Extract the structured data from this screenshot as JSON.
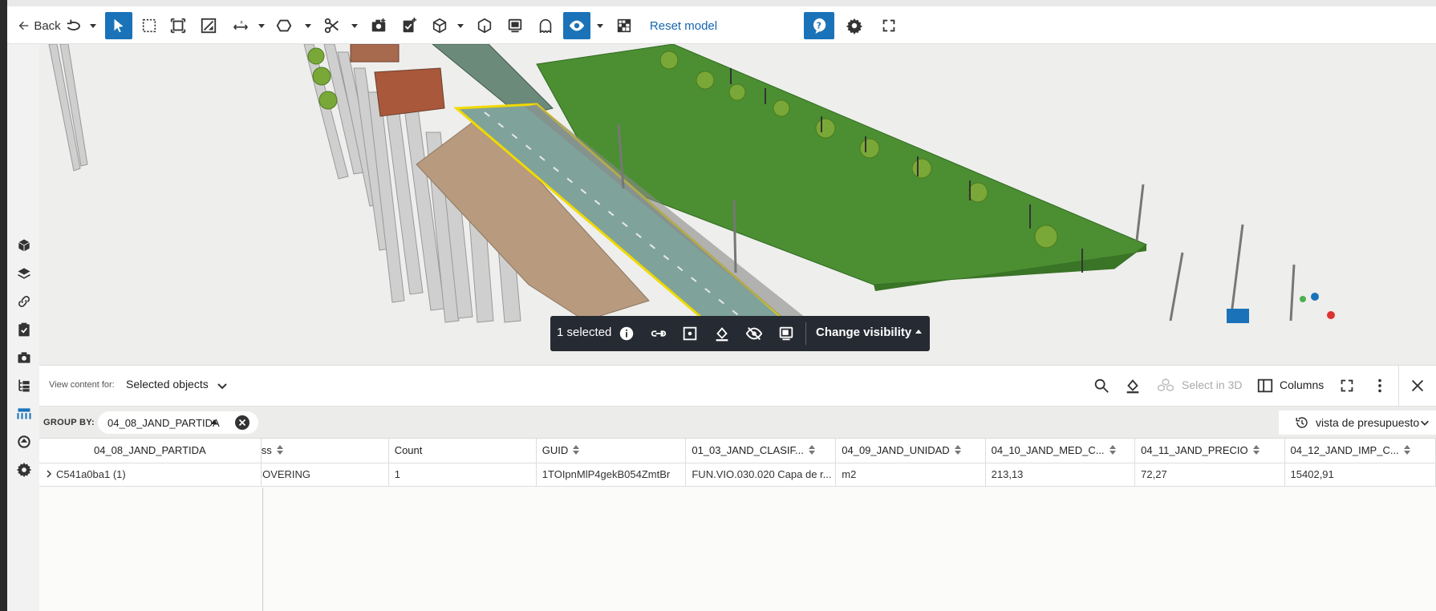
{
  "toolbar": {
    "back_label": "Back",
    "reset_label": "Reset model",
    "icons": [
      "arrow-left-icon",
      "orbit-icon",
      "cursor-icon",
      "box-select-icon",
      "fit-icon",
      "section-icon",
      "measure-icon",
      "shape-icon",
      "scissors-icon",
      "camera-add-icon",
      "clipboard-add-icon",
      "cube-icon",
      "cube-outline-icon",
      "viewer-icon",
      "ghost-icon",
      "eye-icon",
      "checker-icon",
      "help-icon",
      "gear-icon",
      "fullscreen-icon"
    ],
    "accent": "#1a73b8"
  },
  "sidebar": {
    "items": [
      "cube-icon",
      "layers-icon",
      "link-icon",
      "clipboard-check-icon",
      "camera-icon",
      "tree-icon",
      "table-icon",
      "shapes-icon",
      "settings-gear-icon"
    ]
  },
  "selection_bar": {
    "count_label": "1 selected",
    "change_visibility_label": "Change visibility"
  },
  "panel": {
    "view_content_for_label": "View content for:",
    "view_content_for_value": "Selected objects",
    "select_in_3d_label": "Select in 3D",
    "columns_label": "Columns",
    "group_by_label": "GROUP BY:",
    "group_by_value": "04_08_JAND_PARTIDA",
    "view_preset": "vista de presupuesto"
  },
  "table": {
    "columns": [
      "04_08_JAND_PARTIDA",
      "ss",
      "Count",
      "GUID",
      "01_03_JAND_CLASIF...",
      "04_09_JAND_UNIDAD",
      "04_10_JAND_MED_C...",
      "04_11_JAND_PRECIO",
      "04_12_JAND_IMP_C..."
    ],
    "rows": [
      [
        "C541a0ba1 (1)",
        "COVERING",
        "1",
        "1TOIpnMlP4gekB054ZmtBr",
        "FUN.VIO.030.020 Capa de r...",
        "m2",
        "213,13",
        "72,27",
        "15402,91"
      ]
    ]
  }
}
